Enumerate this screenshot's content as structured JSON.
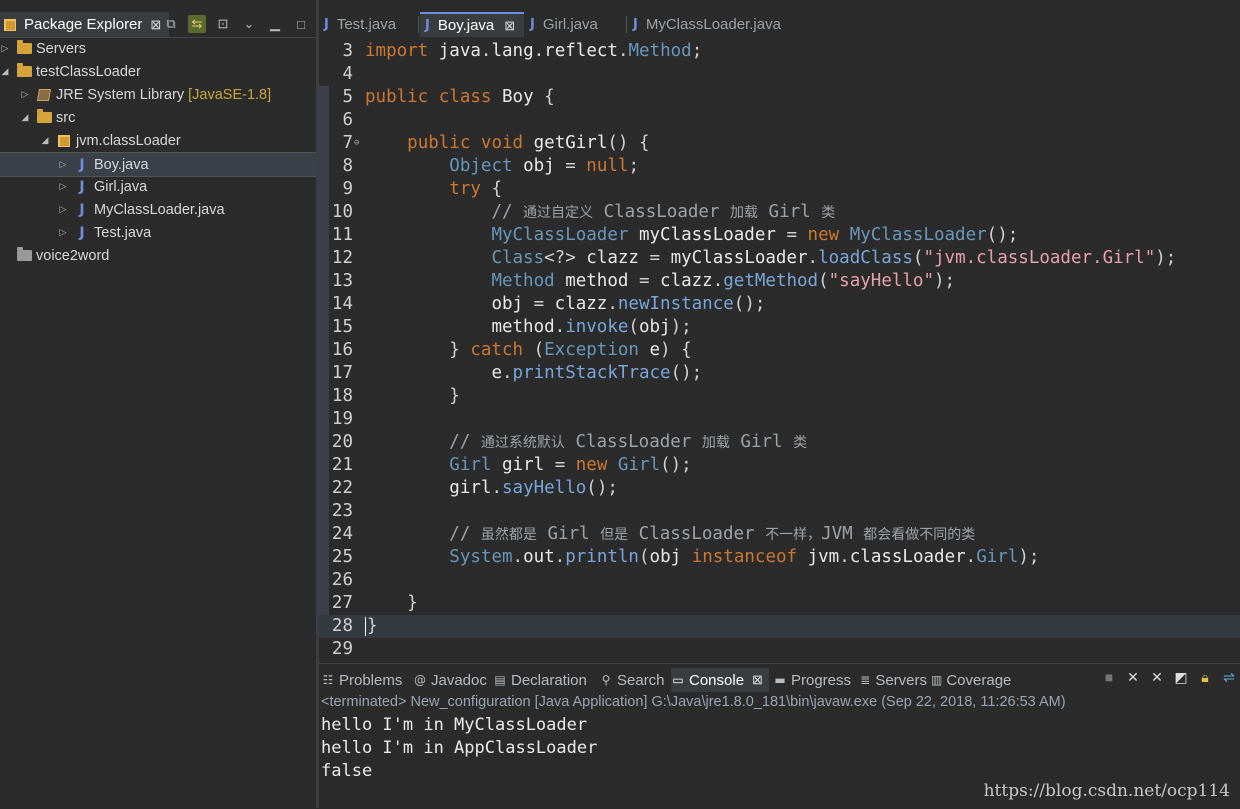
{
  "explorer": {
    "title": "Package Explorer",
    "close": "⊠",
    "tree": [
      {
        "label": "Servers",
        "decoration": "",
        "kind": "folder",
        "expanded": false
      },
      {
        "label": "testClassLoader",
        "decoration": "",
        "kind": "project",
        "expanded": true
      },
      {
        "label": "JRE System Library",
        "decoration": "[JavaSE-1.8]",
        "kind": "library",
        "expanded": false
      },
      {
        "label": "src",
        "decoration": "",
        "kind": "source-folder",
        "expanded": true
      },
      {
        "label": "jvm.classLoader",
        "decoration": "",
        "kind": "package",
        "expanded": true
      },
      {
        "label": "Boy.java",
        "decoration": "",
        "kind": "java",
        "selected": true
      },
      {
        "label": "Girl.java",
        "decoration": "",
        "kind": "java"
      },
      {
        "label": "MyClassLoader.java",
        "decoration": "",
        "kind": "java"
      },
      {
        "label": "Test.java",
        "decoration": "",
        "kind": "java"
      },
      {
        "label": "voice2word",
        "decoration": "",
        "kind": "closed-project"
      }
    ]
  },
  "editor": {
    "tabs": [
      {
        "label": "Test.java",
        "active": false
      },
      {
        "label": "Boy.java",
        "active": true
      },
      {
        "label": "Girl.java",
        "active": false
      },
      {
        "label": "MyClassLoader.java",
        "active": false
      }
    ],
    "tab_icon": "J",
    "lines": [
      {
        "n": "3",
        "text": "import java.lang.reflect.Method;"
      },
      {
        "n": "4",
        "text": ""
      },
      {
        "n": "5",
        "text": "public class Boy {"
      },
      {
        "n": "6",
        "text": ""
      },
      {
        "n": "7",
        "text": "    public void getGirl() {"
      },
      {
        "n": "8",
        "text": "        Object obj = null;"
      },
      {
        "n": "9",
        "text": "        try {"
      },
      {
        "n": "10",
        "text": "            // 通过自定义 ClassLoader 加载 Girl 类"
      },
      {
        "n": "11",
        "text": "            MyClassLoader myClassLoader = new MyClassLoader();"
      },
      {
        "n": "12",
        "text": "            Class<?> clazz = myClassLoader.loadClass(\"jvm.classLoader.Girl\");"
      },
      {
        "n": "13",
        "text": "            Method method = clazz.getMethod(\"sayHello\");"
      },
      {
        "n": "14",
        "text": "            obj = clazz.newInstance();"
      },
      {
        "n": "15",
        "text": "            method.invoke(obj);"
      },
      {
        "n": "16",
        "text": "        } catch (Exception e) {"
      },
      {
        "n": "17",
        "text": "            e.printStackTrace();"
      },
      {
        "n": "18",
        "text": "        }"
      },
      {
        "n": "19",
        "text": ""
      },
      {
        "n": "20",
        "text": "        // 通过系统默认 ClassLoader 加载 Girl 类"
      },
      {
        "n": "21",
        "text": "        Girl girl = new Girl();"
      },
      {
        "n": "22",
        "text": "        girl.sayHello();"
      },
      {
        "n": "23",
        "text": ""
      },
      {
        "n": "24",
        "text": "        // 虽然都是 Girl 但是 ClassLoader 不一样，JVM 都会看做不同的类"
      },
      {
        "n": "25",
        "text": "        System.out.println(obj instanceof jvm.classLoader.Girl);"
      },
      {
        "n": "26",
        "text": ""
      },
      {
        "n": "27",
        "text": "    }"
      },
      {
        "n": "28",
        "text": "}"
      },
      {
        "n": "29",
        "text": ""
      }
    ]
  },
  "console": {
    "tabs": [
      {
        "label": "Problems",
        "icon": "☷",
        "active": false
      },
      {
        "label": "Javadoc",
        "icon": "@",
        "active": false
      },
      {
        "label": "Declaration",
        "icon": "▤",
        "active": false
      },
      {
        "label": "Search",
        "icon": "⚲",
        "active": false
      },
      {
        "label": "Console",
        "icon": "▭",
        "active": true
      },
      {
        "label": "Progress",
        "icon": "▬",
        "active": false
      },
      {
        "label": "Servers",
        "icon": "≣",
        "active": false
      },
      {
        "label": "Coverage",
        "icon": "▥",
        "active": false
      }
    ],
    "status": "<terminated> New_configuration [Java Application] G:\\Java\\jre1.8.0_181\\bin\\javaw.exe (Sep 22, 2018, 11:26:53 AM)",
    "output": [
      "hello I'm in MyClassLoader",
      "hello I'm in AppClassLoader",
      "false"
    ],
    "watermark": "https://blog.csdn.net/ocp114"
  },
  "colors": {
    "keyword": "#cc7832",
    "type": "#6897bb",
    "string": "#e6a0b0",
    "background": "#2b2b2b"
  }
}
